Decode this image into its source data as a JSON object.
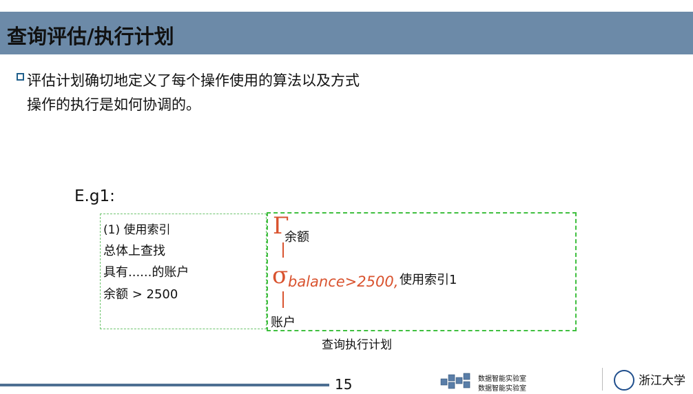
{
  "header": {
    "title": "查询评估/执行计划"
  },
  "body": {
    "bullet_line1": "评估计划确切地定义了每个操作使用的算法以及方式",
    "bullet_line2": "操作的执行是如何协调的。",
    "example_label": "E.g1:"
  },
  "left_box": {
    "line1": "(1) 使用索引",
    "line2": "总体上查找",
    "line3": "具有......的账户",
    "line4": "余额 > 2500"
  },
  "plan": {
    "projection_symbol": "Γ",
    "projection_attr": "余额",
    "selection_symbol": "σ",
    "selection_condition": "balance>2500,",
    "selection_method": "使用索引1",
    "relation": "账户",
    "caption": "查询执行计划"
  },
  "footer": {
    "page_number": "15",
    "lab_name_1": "数据智能实验室",
    "lab_name_2": "数据智能实验室",
    "university": "浙江大学"
  },
  "colors": {
    "title_bar": "#6c8aa8",
    "operator_red": "#d9532f",
    "dashed_green": "#3fbf3f",
    "footer_line": "#4d6f92"
  }
}
